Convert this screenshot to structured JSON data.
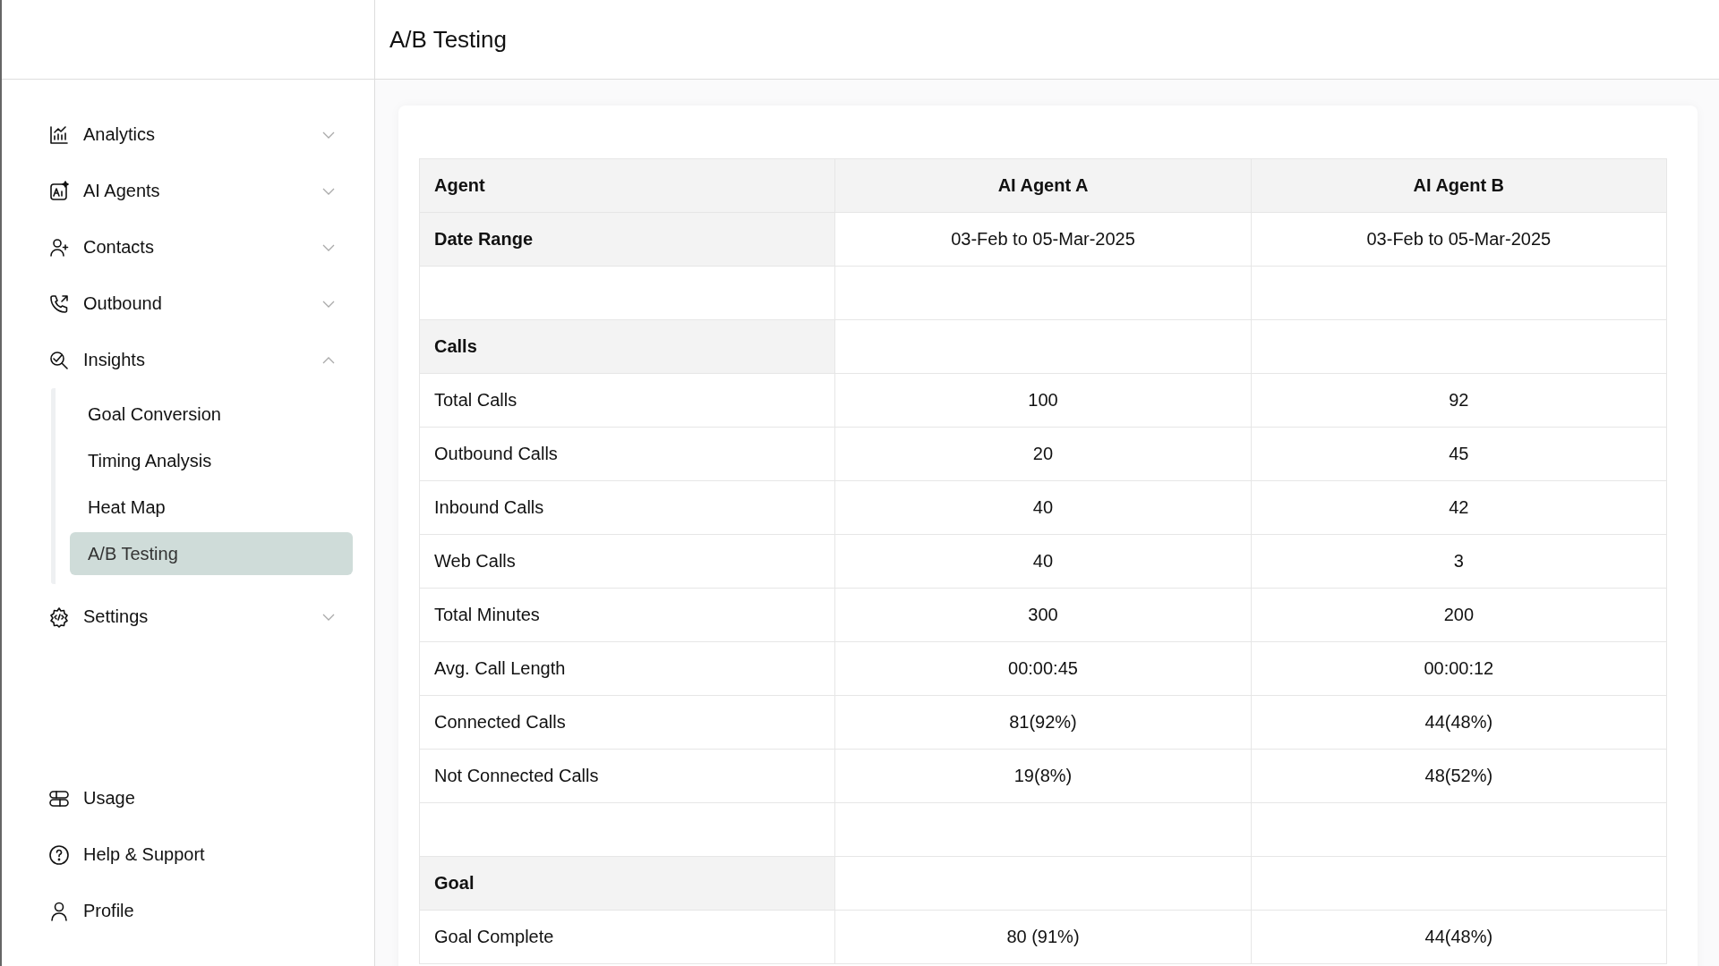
{
  "header": {
    "title": "A/B Testing"
  },
  "sidebar": {
    "items": [
      {
        "label": "Analytics",
        "expanded": false
      },
      {
        "label": "AI Agents",
        "expanded": false
      },
      {
        "label": "Contacts",
        "expanded": false
      },
      {
        "label": "Outbound",
        "expanded": false
      },
      {
        "label": "Insights",
        "expanded": true,
        "children": [
          {
            "label": "Goal Conversion",
            "selected": false
          },
          {
            "label": "Timing Analysis",
            "selected": false
          },
          {
            "label": "Heat Map",
            "selected": false
          },
          {
            "label": "A/B Testing",
            "selected": true
          }
        ]
      },
      {
        "label": "Settings",
        "expanded": false
      }
    ],
    "bottom_items": [
      {
        "label": "Usage"
      },
      {
        "label": "Help & Support"
      },
      {
        "label": "Profile"
      }
    ]
  },
  "table": {
    "rows": [
      {
        "kind": "header",
        "cells": [
          "Agent",
          "AI Agent A",
          "AI Agent B"
        ]
      },
      {
        "kind": "label",
        "cells": [
          "Date Range",
          "03-Feb to 05-Mar-2025",
          "03-Feb to 05-Mar-2025"
        ]
      },
      {
        "kind": "spacer"
      },
      {
        "kind": "section",
        "cells": [
          "Calls"
        ]
      },
      {
        "kind": "data",
        "cells": [
          "Total Calls",
          "100",
          "92"
        ]
      },
      {
        "kind": "data",
        "cells": [
          "Outbound Calls",
          "20",
          "45"
        ]
      },
      {
        "kind": "data",
        "cells": [
          "Inbound Calls",
          "40",
          "42"
        ]
      },
      {
        "kind": "data",
        "cells": [
          "Web Calls",
          "40",
          "3"
        ]
      },
      {
        "kind": "data",
        "cells": [
          "Total Minutes",
          "300",
          "200"
        ]
      },
      {
        "kind": "data",
        "cells": [
          "Avg. Call Length",
          "00:00:45",
          "00:00:12"
        ]
      },
      {
        "kind": "data",
        "cells": [
          "Connected Calls",
          "81(92%)",
          "44(48%)"
        ]
      },
      {
        "kind": "data",
        "cells": [
          "Not Connected Calls",
          "19(8%)",
          "48(52%)"
        ]
      },
      {
        "kind": "spacer"
      },
      {
        "kind": "section",
        "cells": [
          "Goal"
        ]
      },
      {
        "kind": "data",
        "cells": [
          "Goal Complete",
          "80 (91%)",
          "44(48%)"
        ]
      }
    ]
  }
}
